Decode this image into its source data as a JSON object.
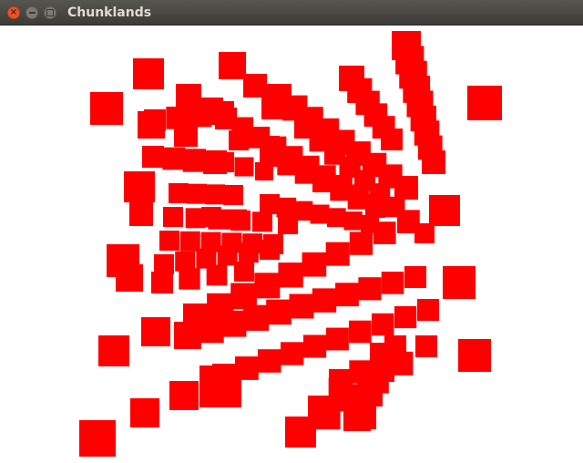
{
  "window": {
    "title": "Chunklands",
    "close_icon": "close-icon",
    "minimize_icon": "minimize-icon",
    "maximize_icon": "maximize-icon"
  },
  "scene": {
    "background": "#ffffff",
    "chunk_color": "#ff0000"
  }
}
